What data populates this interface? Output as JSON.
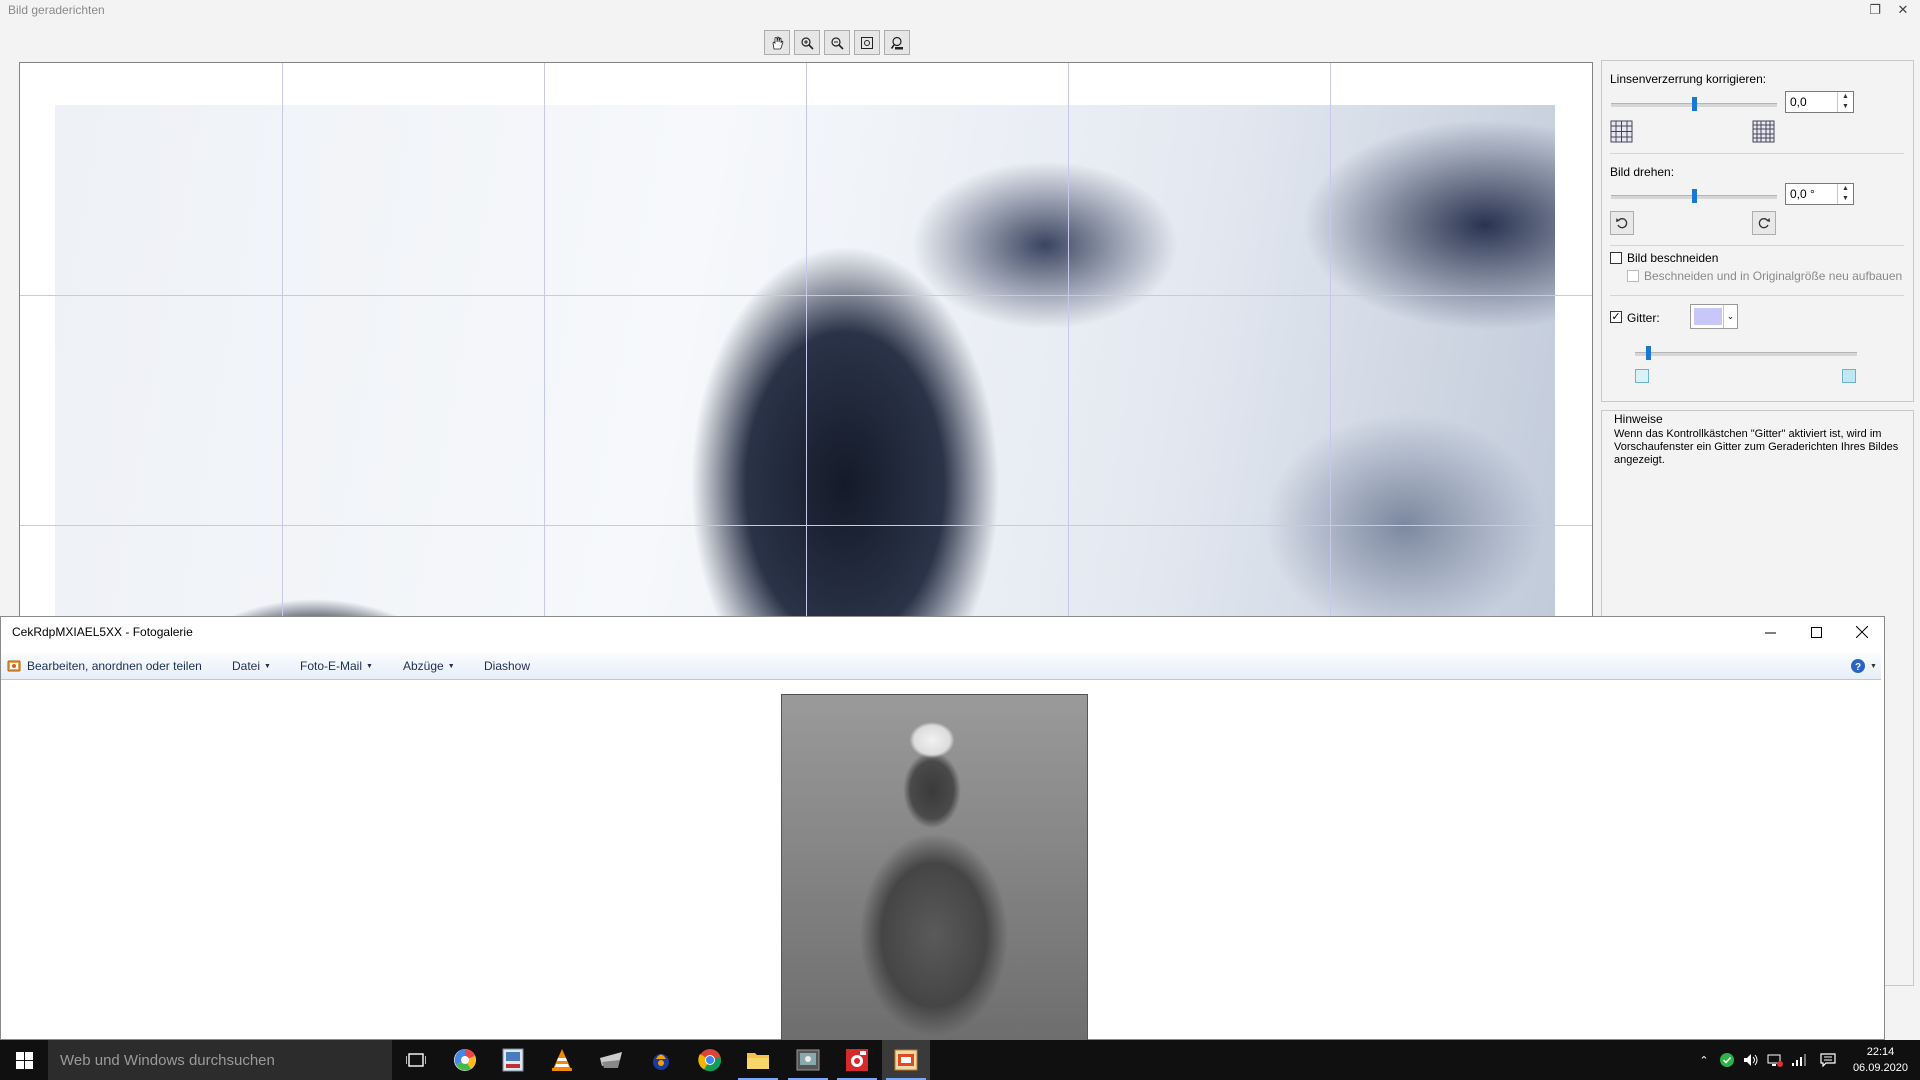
{
  "straighten_window": {
    "title": "Bild geraderichten",
    "toolbar_icons": [
      "hand-icon",
      "zoom-in-icon",
      "zoom-out-icon",
      "fit-icon",
      "zoom-100-icon"
    ],
    "lens": {
      "label": "Linsenverzerrung korrigieren:",
      "value": "0,0",
      "slider_fraction": 0.5
    },
    "rotate": {
      "label": "Bild drehen:",
      "value": "0,0 °",
      "slider_fraction": 0.5
    },
    "crop": {
      "label": "Bild beschneiden",
      "checked": false,
      "sub_label": "Beschneiden und in Originalgröße neu aufbauen"
    },
    "grid": {
      "label": "Gitter:",
      "checked": true,
      "color": "#c8c8f8",
      "slider_fraction": 0.06
    },
    "hints": {
      "title": "Hinweise",
      "text": "Wenn das Kontrollkästchen \"Gitter\" aktiviert ist, wird im Vorschaufenster ein Gitter zum Geraderichten Ihres Bildes angezeigt."
    }
  },
  "gallery_window": {
    "title": "CekRdpMXIAEL5XX - Fotogalerie",
    "menu": {
      "edit": "Bearbeiten, anordnen oder teilen",
      "file": "Datei",
      "email": "Foto-E-Mail",
      "prints": "Abzüge",
      "slideshow": "Diashow"
    }
  },
  "taskbar": {
    "search_placeholder": "Web und Windows durchsuchen",
    "time": "22:14",
    "date": "06.09.2020"
  }
}
